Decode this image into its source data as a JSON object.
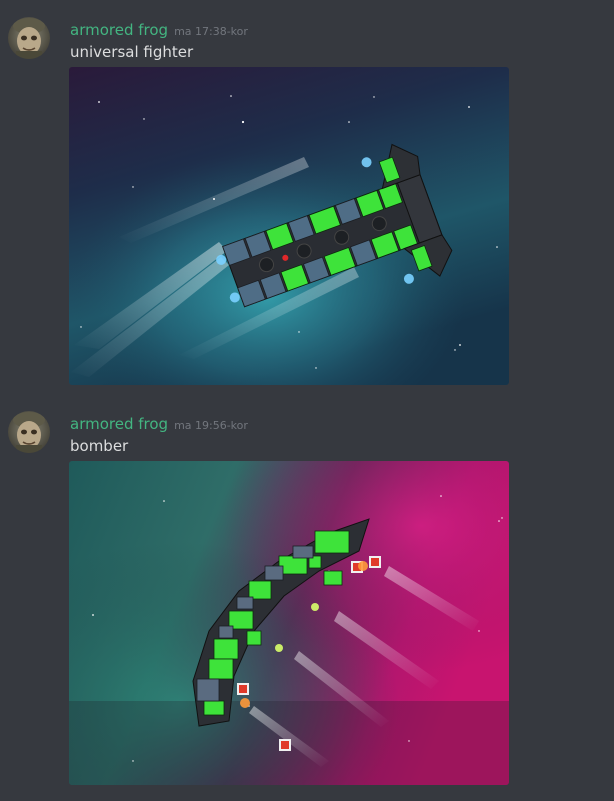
{
  "messages": [
    {
      "author": "armored frog",
      "timestamp": "ma 17:38-kor",
      "text": "universal fighter",
      "author_color": "#43b581",
      "attachment": {
        "kind": "screenshot-image",
        "scene": "spaceship-fighter-teal-nebula"
      }
    },
    {
      "author": "armored frog",
      "timestamp": "ma 19:56-kor",
      "text": "bomber",
      "author_color": "#43b581",
      "attachment": {
        "kind": "screenshot-image",
        "scene": "spaceship-bomber-pink-nebula"
      }
    }
  ],
  "theme": {
    "background": "#36393f",
    "text": "#dcddde",
    "muted": "#72767d"
  }
}
